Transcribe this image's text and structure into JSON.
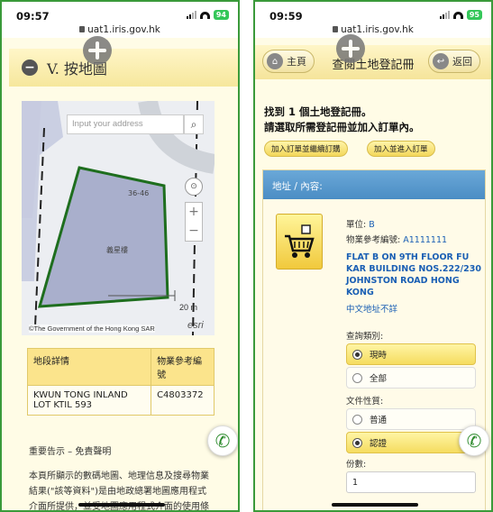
{
  "phone1": {
    "status": {
      "time": "09:57",
      "battery": "94",
      "url": "uat1.iris.gov.hk"
    },
    "section": {
      "minus_icon": "−",
      "title": "V. 按地圖"
    },
    "map": {
      "search_placeholder": "Input your address",
      "search_icon": "magnifier",
      "lot_number_label": "36-46",
      "building_label": "義星樓",
      "zoom_in": "+",
      "zoom_out": "−",
      "scale_label": "20 m",
      "attribution": "©The Government of the Hong Kong SAR",
      "esri": "esri"
    },
    "lot_table": {
      "headers": [
        "地段詳情",
        "物業參考編號"
      ],
      "rows": [
        [
          "KWUN TONG INLAND LOT KTIL 593",
          "C4803372"
        ]
      ]
    },
    "disclaimer_title": "重要告示 – 免責聲明",
    "disclaimer_text": "本頁所顯示的數碼地圖、地理信息及搜尋物業結果(\"該等資料\")是由地政總署地圖應用程式介面所提供，並受地圖應用程式介面的使用條"
  },
  "phone2": {
    "status": {
      "time": "09:59",
      "battery": "95",
      "url": "uat1.iris.gov.hk"
    },
    "topbar": {
      "home_label": "主頁",
      "title": "查閱土地登記冊",
      "back_label": "返回"
    },
    "found_line1": "找到 1 個土地登記冊。",
    "found_line2": "請選取所需登記冊並加入訂單內。",
    "btn_add_continue": "加入訂單並繼續訂購",
    "btn_add_checkout": "加入並進入訂單",
    "card": {
      "header": "地址 / 內容:",
      "unit_label": "單位: ",
      "unit_value": "B",
      "ref_label": "物業參考編號: ",
      "ref_value": "A1111111",
      "address": "FLAT B ON 9TH FLOOR FU KAR BUILDING NOS.222/230 JOHNSTON ROAD HONG KONG",
      "cn_addr": "中文地址不詳",
      "search_type_label": "查詢類別:",
      "search_types": [
        "現時",
        "全部"
      ],
      "doc_type_label": "文件性質:",
      "doc_types": [
        "普通",
        "認證"
      ],
      "copies_label": "份數:",
      "copies_value": "1"
    }
  },
  "colors": {
    "frame": "#3a9a3a",
    "accent": "#f5dc5f",
    "header_blue": "#4b8dc4",
    "link": "#1a5fb4"
  }
}
